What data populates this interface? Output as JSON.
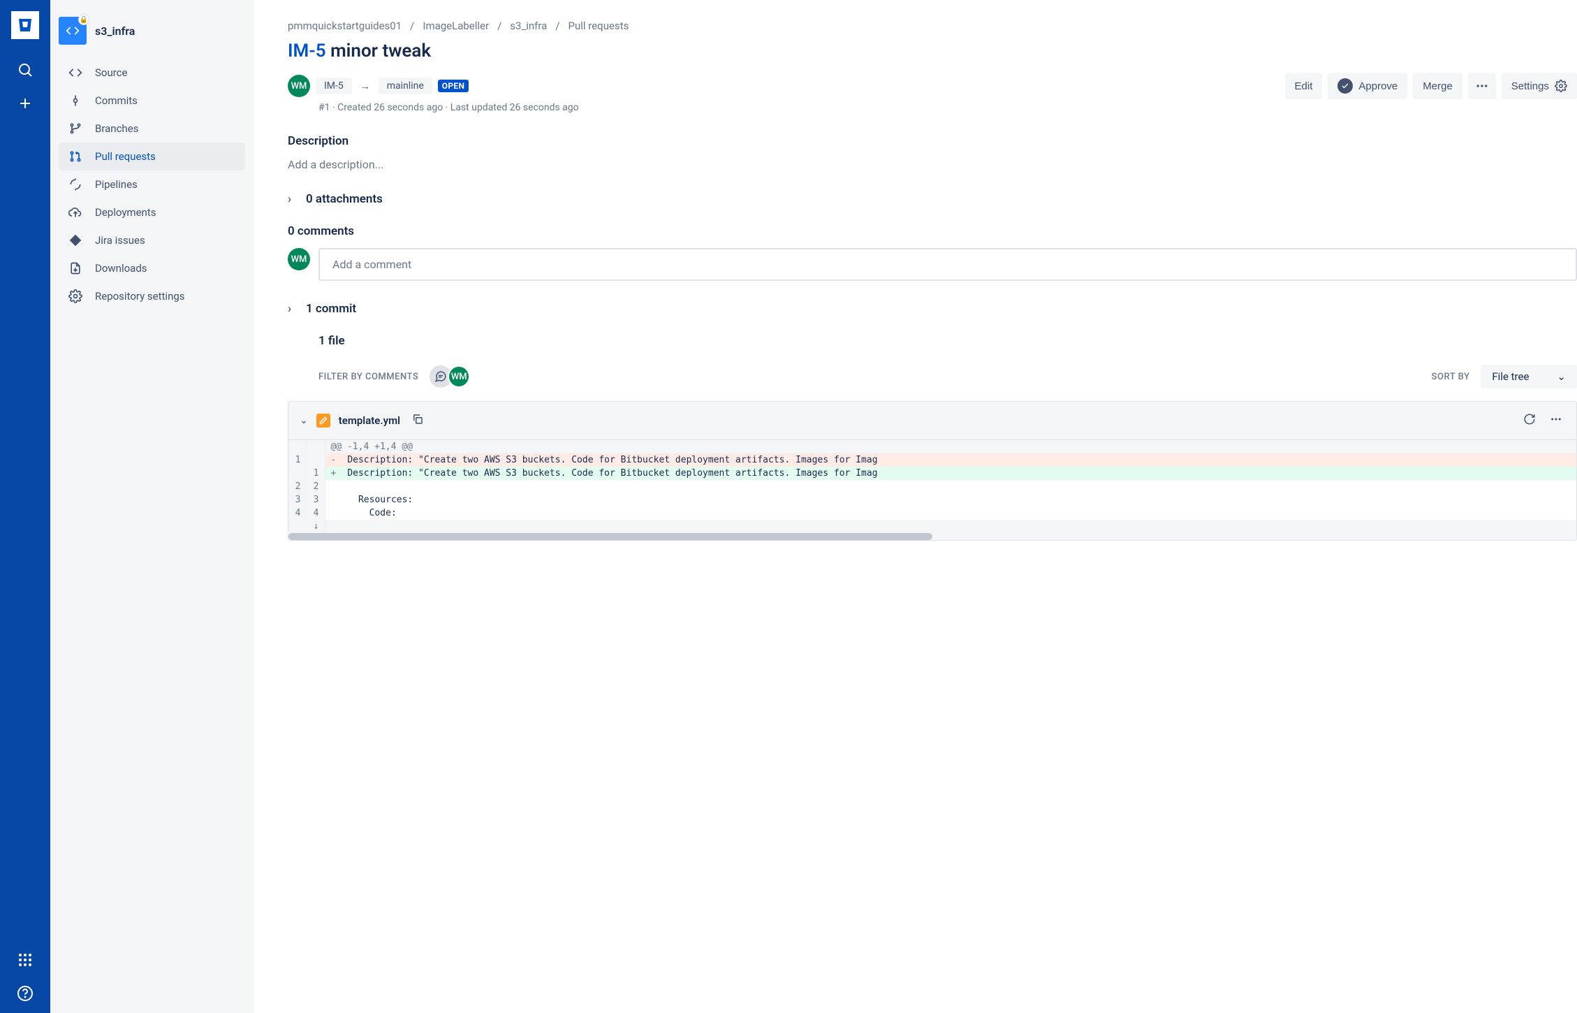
{
  "repo": {
    "name": "s3_infra",
    "initials": "WM"
  },
  "sidebar": {
    "items": [
      {
        "label": "Source"
      },
      {
        "label": "Commits"
      },
      {
        "label": "Branches"
      },
      {
        "label": "Pull requests"
      },
      {
        "label": "Pipelines"
      },
      {
        "label": "Deployments"
      },
      {
        "label": "Jira issues"
      },
      {
        "label": "Downloads"
      },
      {
        "label": "Repository settings"
      }
    ]
  },
  "breadcrumb": {
    "w": "pmmquickstartguides01",
    "p": "ImageLabeller",
    "r": "s3_infra",
    "s": "Pull requests"
  },
  "pr": {
    "id": "IM-5",
    "title": "minor tweak",
    "source": "IM-5",
    "target": "mainline",
    "state": "OPEN",
    "meta": "#1 · Created 26 seconds ago · Last updated 26 seconds ago"
  },
  "actions": {
    "edit": "Edit",
    "approve": "Approve",
    "merge": "Merge",
    "settings": "Settings"
  },
  "sections": {
    "description": "Description",
    "desc_placeholder": "Add a description...",
    "attachments": "0 attachments",
    "comments": "0 comments",
    "comment_placeholder": "Add a comment",
    "commits": "1 commit",
    "files": "1 file",
    "filter_label": "FILTER BY COMMENTS",
    "sort_label": "SORT BY",
    "sort_value": "File tree"
  },
  "diff": {
    "filename": "template.yml",
    "hunk": "@@ -1,4 +1,4 @@",
    "lines": [
      {
        "oldNo": "1",
        "newNo": "",
        "mark": "-",
        "text": "Description: \"Create two AWS S3 buckets. Code for Bitbucket deployment artifacts. Images for Imag",
        "type": "del"
      },
      {
        "oldNo": "",
        "newNo": "1",
        "mark": "+",
        "text": "Description: \"Create two AWS S3 buckets. Code for Bitbucket deployment artifacts. Images for Imag",
        "type": "add"
      },
      {
        "oldNo": "2",
        "newNo": "2",
        "mark": "",
        "text": "",
        "type": "ctx"
      },
      {
        "oldNo": "3",
        "newNo": "3",
        "mark": "",
        "text": "  Resources:",
        "type": "ctx"
      },
      {
        "oldNo": "4",
        "newNo": "4",
        "mark": "",
        "text": "    Code:",
        "type": "ctx"
      }
    ]
  }
}
